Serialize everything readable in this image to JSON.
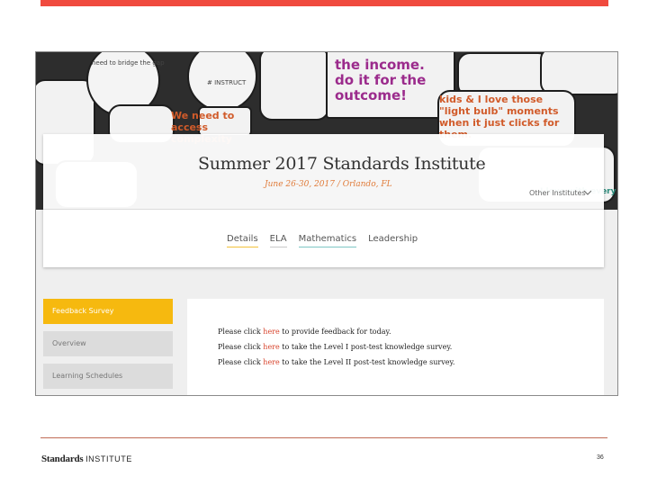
{
  "header": {
    "title": "Summer 2017 Standards Institute",
    "subtitle": "June 26-30, 2017 / Orlando, FL",
    "other_institutes": "Other Institutes"
  },
  "tabs": [
    {
      "label": "Details"
    },
    {
      "label": "ELA"
    },
    {
      "label": "Mathematics"
    },
    {
      "label": "Leadership"
    }
  ],
  "sidebar": {
    "items": [
      {
        "label": "Feedback Survey",
        "active": true
      },
      {
        "label": "Overview",
        "active": false
      },
      {
        "label": "Learning Schedules",
        "active": false
      }
    ]
  },
  "content": {
    "lines": [
      {
        "pre": "Please click ",
        "link": "here",
        "post": " to provide feedback for today."
      },
      {
        "pre": "Please click ",
        "link": "here",
        "post": " to take the Level I post-test knowledge survey."
      },
      {
        "pre": "Please click ",
        "link": "here",
        "post": " to take the Level II post-test knowledge survey."
      }
    ]
  },
  "banner": {
    "notes": [
      "need to bridge the gap",
      "# INSTRUCT",
      "the income. do it for the outcome!",
      "kids & I love those \"light bulb\" moments when it just clicks for them.",
      "We need to access complexity",
      "I love with every"
    ]
  },
  "footer": {
    "logo_main": "Standards",
    "logo_small": "INSTITUTE",
    "page_number": "36"
  },
  "colors": {
    "accent_red": "#f04a3e",
    "sidebar_active": "#f6b90f",
    "link": "#d8452e",
    "subtitle": "#e07b39"
  }
}
